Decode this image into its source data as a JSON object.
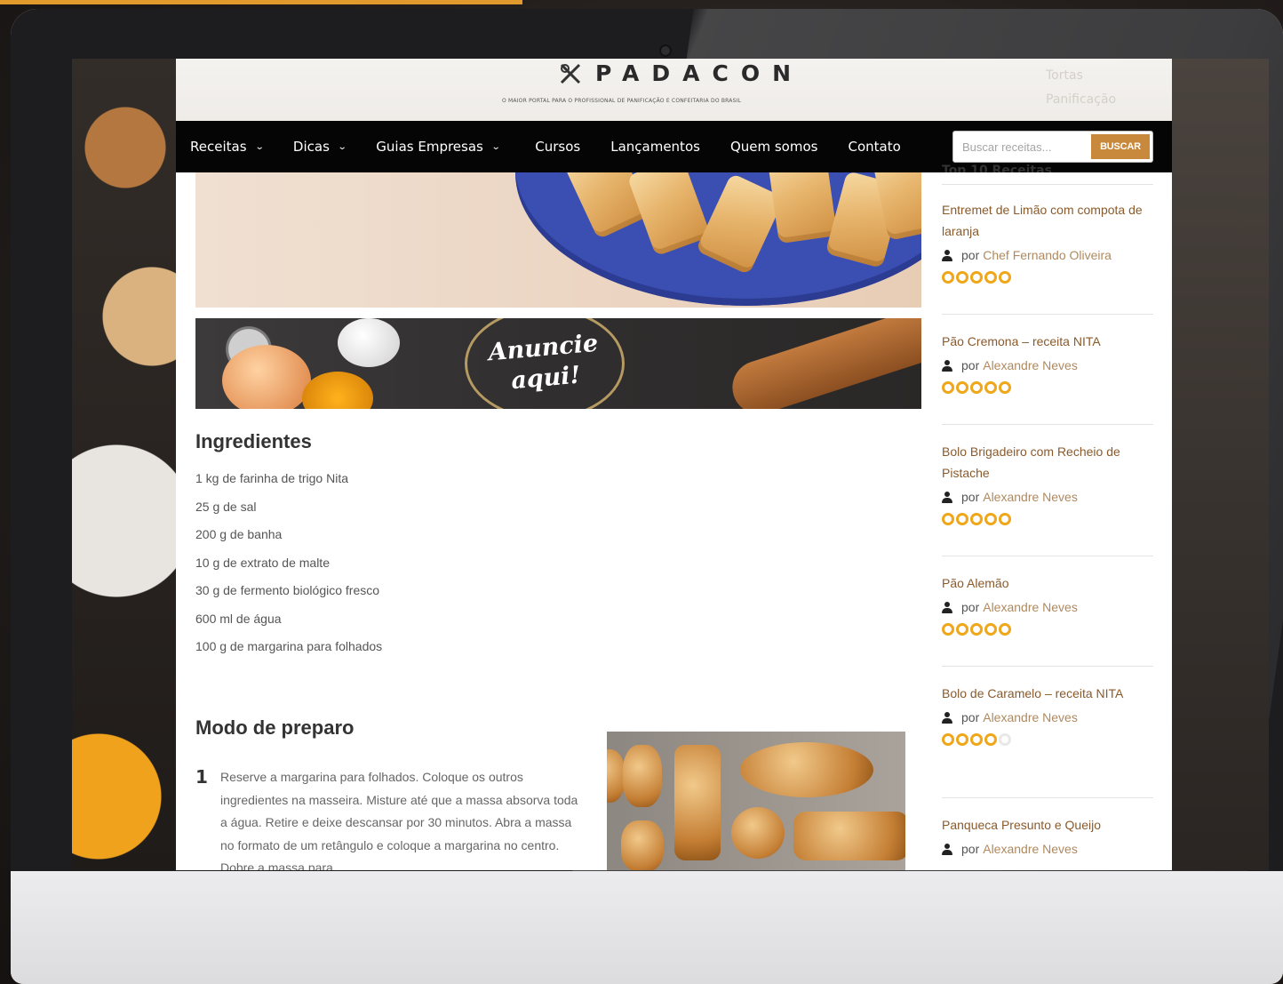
{
  "site": {
    "logo_text": "PADACON",
    "tagline": "O MAIOR PORTAL PARA O PROFISSIONAL DE PANIFICAÇÃO E CONFEITARIA DO BRASIL"
  },
  "sidebar_faded": [
    "Tortas",
    "Panificação"
  ],
  "nav": {
    "items": [
      {
        "label": "Receitas",
        "has_dropdown": true
      },
      {
        "label": "Dicas",
        "has_dropdown": true
      },
      {
        "label": "Guias Empresas",
        "has_dropdown": true
      },
      {
        "label": "Cursos",
        "has_dropdown": false
      },
      {
        "label": "Lançamentos",
        "has_dropdown": false
      },
      {
        "label": "Quem somos",
        "has_dropdown": false
      },
      {
        "label": "Contato",
        "has_dropdown": false
      }
    ],
    "search_placeholder": "Buscar receitas...",
    "search_button": "BUSCAR"
  },
  "ad": {
    "text": "Anuncie\naqui!"
  },
  "ingredients": {
    "heading": "Ingredientes",
    "items": [
      "1 kg de farinha de trigo Nita",
      "25 g de sal",
      "200 g de banha",
      "10 g de extrato de malte",
      "30 g de fermento biológico fresco",
      "600 ml de água",
      "100 g de margarina para folhados"
    ]
  },
  "preparo": {
    "heading": "Modo de preparo",
    "steps": [
      {
        "number": "1",
        "text": "Reserve a margarina para folhados. Coloque os outros ingredientes na masseira. Misture até que a massa absorva toda a água. Retire e deixe descansar por 30 minutos. Abra a massa no formato de um retângulo e coloque a margarina no centro. Dobre a massa para"
      }
    ]
  },
  "sidebar": {
    "title": "Top 10 Receitas",
    "by_label": "por",
    "recipes": [
      {
        "title": "Entremet de Limão com compota de laranja",
        "author": "Chef Fernando Oliveira",
        "rating": 5
      },
      {
        "title": "Pão Cremona – receita NITA",
        "author": "Alexandre Neves",
        "rating": 5
      },
      {
        "title": "Bolo Brigadeiro com Recheio de Pistache",
        "author": "Alexandre Neves",
        "rating": 5
      },
      {
        "title": "Pão Alemão",
        "author": "Alexandre Neves",
        "rating": 5
      },
      {
        "title": "Bolo de Caramelo – receita NITA",
        "author": "Alexandre Neves",
        "rating": 4
      },
      {
        "title": "Panqueca Presunto e Queijo",
        "author": "Alexandre Neves",
        "rating": null
      }
    ]
  },
  "colors": {
    "accent": "#c8893c",
    "nav_bg": "#050505",
    "link_brown": "#8a5a2b",
    "star": "#f0a61a"
  }
}
